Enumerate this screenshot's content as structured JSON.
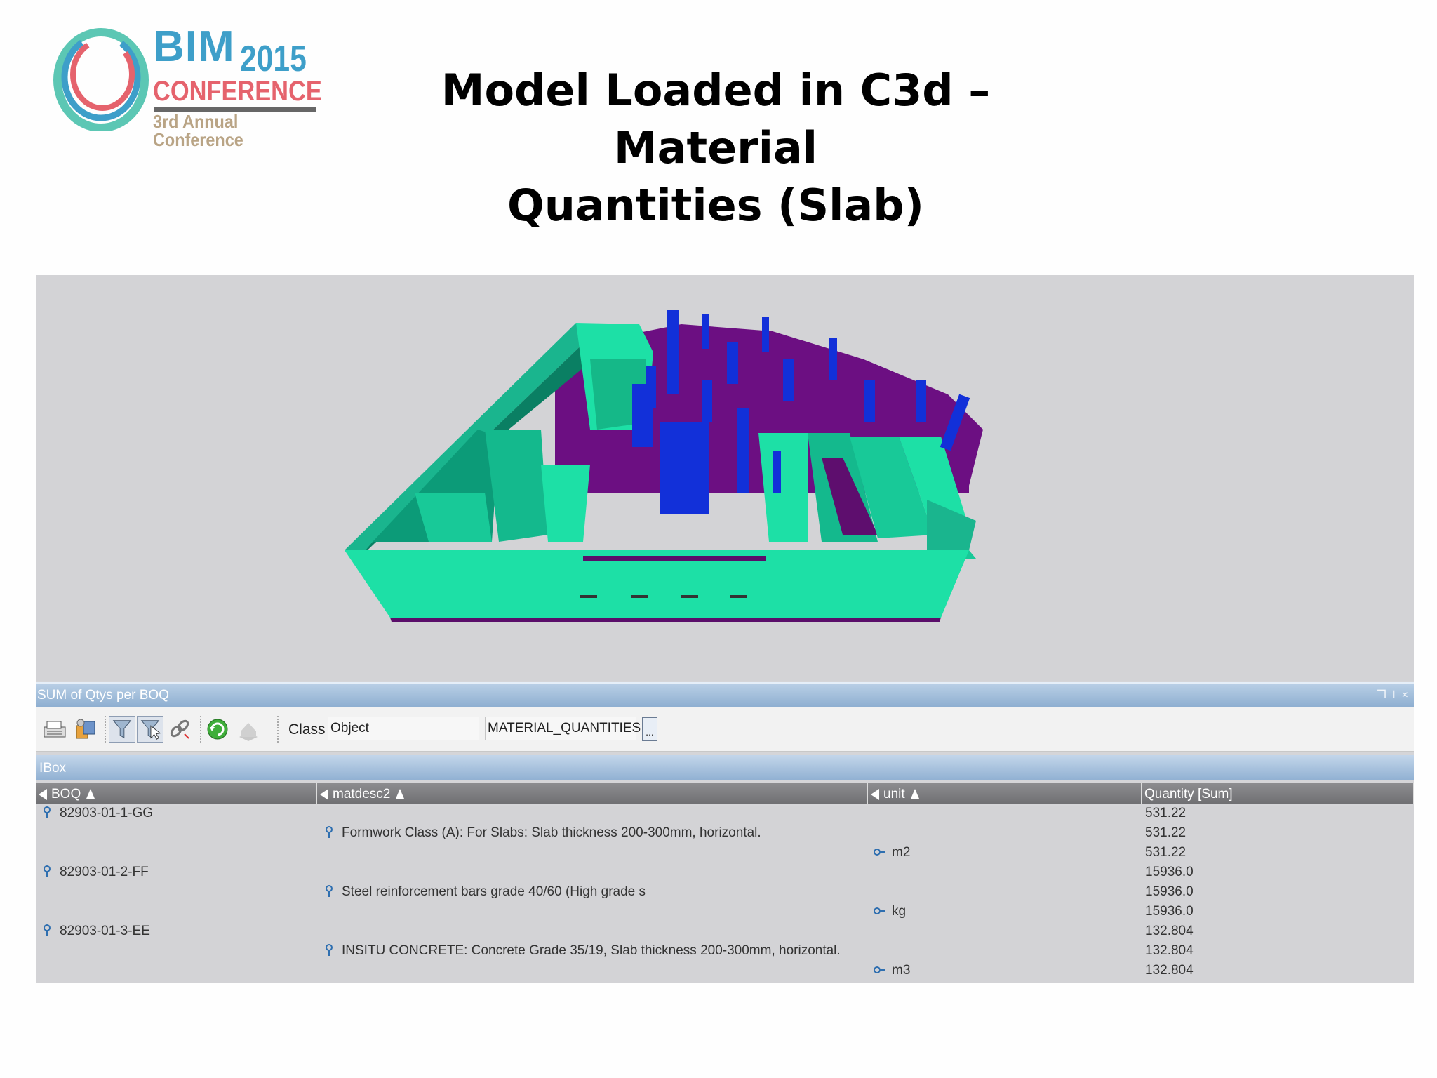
{
  "logo": {
    "brand": "BIM",
    "year": "2015",
    "line2": "CONFERENCE",
    "line3": "3rd Annual Conference"
  },
  "slide": {
    "title_line1": "Model Loaded in C3d – Material",
    "title_line2": "Quantities (Slab)"
  },
  "panel": {
    "title": "SUM of Qtys per BOQ",
    "class_label": "Class",
    "class_value": "Object",
    "filter_value": "MATERIAL_QUANTITIES",
    "more_label": "...",
    "group_label": "IBox"
  },
  "table": {
    "columns": [
      "BOQ",
      "matdesc2",
      "unit",
      "Quantity [Sum]"
    ],
    "rows": [
      {
        "boq": "82903-01-1-GG",
        "desc": "",
        "unit": "",
        "qty": "531.22"
      },
      {
        "boq": "",
        "desc": "Formwork Class (A): For Slabs: Slab thickness 200-300mm, horizontal.",
        "unit": "",
        "qty": "531.22"
      },
      {
        "boq": "",
        "desc": "",
        "unit": "m2",
        "qty": "531.22"
      },
      {
        "boq": "82903-01-2-FF",
        "desc": "",
        "unit": "",
        "qty": "15936.0"
      },
      {
        "boq": "",
        "desc": "Steel reinforcement bars grade 40/60 (High grade s",
        "unit": "",
        "qty": "15936.0"
      },
      {
        "boq": "",
        "desc": "",
        "unit": "kg",
        "qty": "15936.0"
      },
      {
        "boq": "82903-01-3-EE",
        "desc": "",
        "unit": "",
        "qty": "132.804"
      },
      {
        "boq": "",
        "desc": "INSITU CONCRETE: Concrete Grade 35/19, Slab thickness 200-300mm, horizontal.",
        "unit": "",
        "qty": "132.804"
      },
      {
        "boq": "",
        "desc": "",
        "unit": "m3",
        "qty": "132.804"
      }
    ]
  },
  "colors": {
    "walls": "#1de0a6",
    "slab": "#6c0f82",
    "columns": "#1230d9",
    "viewport_bg": "#d3d3d6",
    "panel_header": "#8daed0"
  },
  "icons": [
    "report-icon",
    "objects-icon",
    "filter-icon",
    "select-filter-icon",
    "unlink-icon",
    "refresh-icon",
    "layers-icon"
  ]
}
